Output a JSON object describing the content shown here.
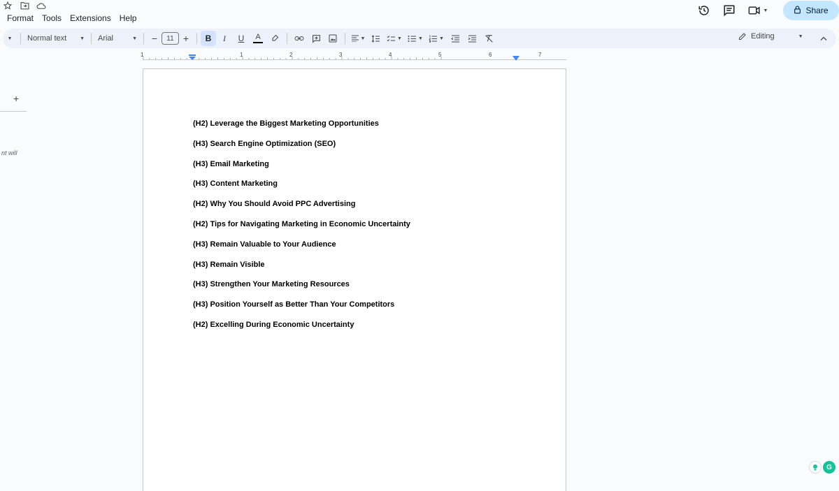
{
  "menu": {
    "items": [
      "Format",
      "Tools",
      "Extensions",
      "Help"
    ]
  },
  "header": {
    "share_label": "Share"
  },
  "toolbar": {
    "style_label": "Normal text",
    "font_label": "Arial",
    "font_size": "11",
    "mode_label": "Editing"
  },
  "ruler": {
    "numbers": [
      "1",
      "1",
      "2",
      "3",
      "4",
      "5",
      "6",
      "7"
    ]
  },
  "left_panel": {
    "snippet": "nt will"
  },
  "document": {
    "lines": [
      "(H2) Leverage the Biggest Marketing Opportunities",
      "(H3) Search Engine Optimization (SEO)",
      "(H3) Email Marketing",
      "(H3) Content Marketing",
      "(H2) Why You Should Avoid PPC Advertising",
      "(H2) Tips for Navigating Marketing in Economic Uncertainty",
      "(H3) Remain Valuable to Your Audience",
      "(H3) Remain Visible",
      "(H3) Strengthen Your Marketing Resources",
      "(H3) Position Yourself as Better Than Your Competitors",
      "(H2) Excelling During Economic Uncertainty"
    ]
  },
  "colors": {
    "share_bg": "#c2e7ff",
    "toolbar_bg": "#edf2fa",
    "bold_active": "#d3e3fd",
    "ruler_marker": "#4285f4"
  },
  "icons": {
    "title": [
      "star-icon",
      "folder-move-icon",
      "cloud-saved-icon"
    ],
    "header": [
      "history-icon",
      "comment-icon",
      "video-call-icon",
      "lock-icon"
    ]
  }
}
